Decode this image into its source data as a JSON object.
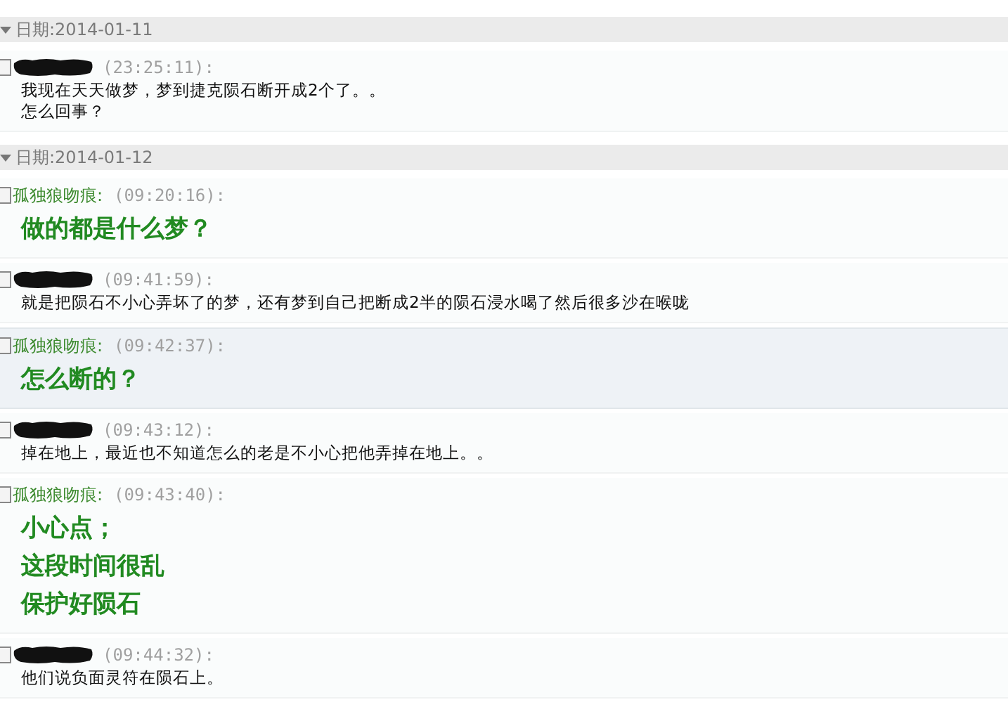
{
  "days": [
    {
      "date": "日期:2014-01-11",
      "expanded": true,
      "messages": [
        {
          "kind": "other",
          "checked": false,
          "time": "(23:25:11):",
          "highlighted": false,
          "lines": [
            "我现在天天做梦，梦到捷克陨石断开成2个了。。",
            "怎么回事？"
          ]
        }
      ]
    },
    {
      "date": "日期:2014-01-12",
      "expanded": true,
      "messages": [
        {
          "kind": "self",
          "checked": false,
          "sender": "孤独狼吻痕:",
          "time": "(09:20:16):",
          "highlighted": false,
          "lines": [
            "做的都是什么梦？"
          ]
        },
        {
          "kind": "other",
          "checked": false,
          "time": "(09:41:59):",
          "highlighted": false,
          "lines": [
            "就是把陨石不小心弄坏了的梦，还有梦到自己把断成2半的陨石浸水喝了然后很多沙在喉咙"
          ]
        },
        {
          "kind": "self",
          "checked": false,
          "sender": "孤独狼吻痕:",
          "time": "(09:42:37):",
          "highlighted": true,
          "lines": [
            "怎么断的？"
          ]
        },
        {
          "kind": "other",
          "checked": false,
          "time": "(09:43:12):",
          "highlighted": false,
          "lines": [
            "掉在地上，最近也不知道怎么的老是不小心把他弄掉在地上。。"
          ]
        },
        {
          "kind": "self",
          "checked": false,
          "sender": "孤独狼吻痕:",
          "time": "(09:43:40):",
          "highlighted": false,
          "lines": [
            "小心点；",
            "这段时间很乱",
            "保护好陨石"
          ]
        },
        {
          "kind": "other",
          "checked": false,
          "time": "(09:44:32):",
          "highlighted": false,
          "lines": [
            "他们说负面灵符在陨石上。"
          ]
        }
      ]
    }
  ]
}
